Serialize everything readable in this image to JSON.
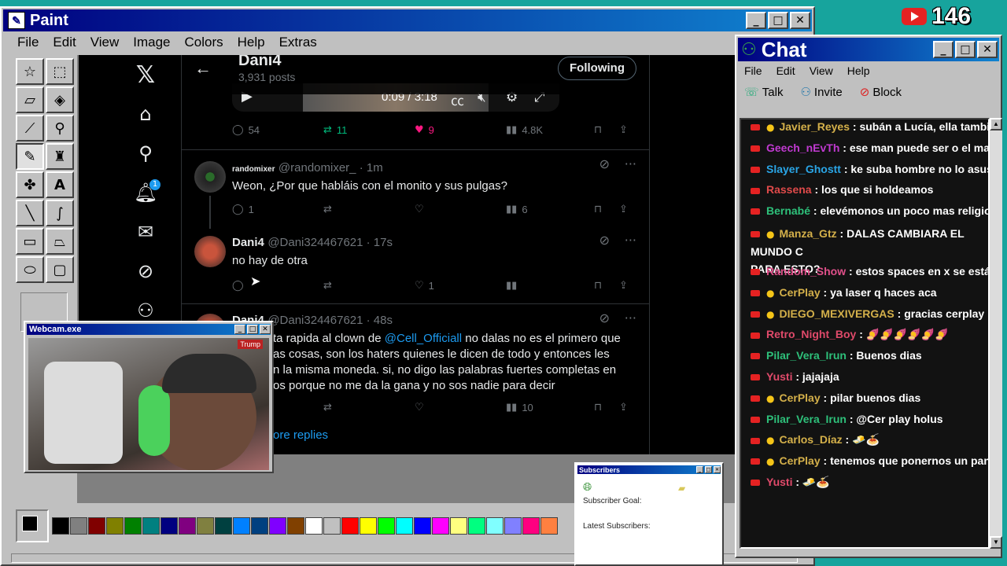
{
  "paint": {
    "title": "Paint",
    "menu": [
      "File",
      "Edit",
      "View",
      "Image",
      "Colors",
      "Help",
      "Extras"
    ],
    "tools": [
      "free-select",
      "rect-select",
      "eraser",
      "fill",
      "color-picker",
      "magnifier",
      "pencil",
      "brush",
      "airbrush",
      "text",
      "line",
      "curve",
      "rectangle",
      "polygon",
      "ellipse",
      "rounded-rectangle"
    ],
    "palette": [
      "#000000",
      "#808080",
      "#800000",
      "#808000",
      "#008000",
      "#008080",
      "#000080",
      "#800080",
      "#808040",
      "#004040",
      "#0080ff",
      "#004080",
      "#8000ff",
      "#804000",
      "#ffffff",
      "#c0c0c0",
      "#ff0000",
      "#ffff00",
      "#00ff00",
      "#00ffff",
      "#0000ff",
      "#ff00ff",
      "#ffff80",
      "#00ff80",
      "#80ffff",
      "#8080ff",
      "#ff0080",
      "#ff8040"
    ]
  },
  "x": {
    "header": {
      "name": "Dani4",
      "posts": "3,931 posts",
      "follow_label": "Following"
    },
    "video": {
      "time": "0:09 / 3:18"
    },
    "first_actions": {
      "replies": "54",
      "reposts": "11",
      "likes": "9",
      "views": "4.8K"
    },
    "posts": [
      {
        "name": "randomixer",
        "handle": "@randomixer_ · 1m",
        "text": "Weon, ¿Por que habláis con el monito y sus pulgas?",
        "replies": "1",
        "reposts": "",
        "likes": "",
        "views": "6"
      },
      {
        "name": "Dani4",
        "handle": "@Dani324467621 · 17s",
        "text": "no hay de otra",
        "replies": "",
        "reposts": "",
        "likes": "1",
        "views": ""
      },
      {
        "name": "Dani4",
        "handle": "@Dani324467621 · 48s",
        "text_pre": "ta rapida al clown de ",
        "mention": "@Cell_Officiall",
        "text_post": " no dalas no es el primero que",
        "lines": [
          "as cosas, son los haters quienes le dicen de todo y entonces les",
          "n la misma moneda. si, no digo las palabras fuertes completas en",
          "os porque no me da la gana y no sos nadie para decir"
        ],
        "replies": "",
        "reposts": "",
        "likes": "",
        "views": "10"
      }
    ],
    "more_replies": "ore replies"
  },
  "webcam": {
    "title": "Webcam.exe",
    "badge": "Trump"
  },
  "chat": {
    "title": "Chat",
    "menu": [
      "File",
      "Edit",
      "View",
      "Help"
    ],
    "toolbar": [
      "Talk",
      "Invite",
      "Block"
    ],
    "messages": [
      {
        "user": "Javier_Reyes",
        "color": "#d4b04a",
        "text": "subán a Lucía, ella también atra"
      },
      {
        "user": "Geech_nEvTh",
        "color": "#c03ad0",
        "text": "ese man puede ser o el mayor p"
      },
      {
        "user": "Slayer_Ghostt",
        "color": "#2aa5e6",
        "text": "ke suba hombre no lo asusten"
      },
      {
        "user": "Rassena",
        "color": "#e04a4a",
        "text": "los que si holdeamos"
      },
      {
        "user": "Bernabé",
        "color": "#2ec07a",
        "text": "elevémonos un poco mas religioso"
      },
      {
        "user": "Manza_Gtz",
        "color": "#d4b04a",
        "text": "DALAS CAMBIARA EL MUNDO C",
        "cont": "PARA ESTO?"
      },
      {
        "user": "Random_Show",
        "color": "#e0508a",
        "text": "estos spaces en x se están vol"
      },
      {
        "user": "CerPlay",
        "color": "#d4b04a",
        "text": "ya laser q haces aca"
      },
      {
        "user": "DIEGO_MEXIVERGAS",
        "color": "#d4b04a",
        "text": "gracias cerplay"
      },
      {
        "user": "Retro_Night_Boy",
        "color": "#e04a6a",
        "text": "🍠🍠🍠🍠🍠🍠"
      },
      {
        "user": "Pilar_Vera_Irun",
        "color": "#2ec07a",
        "text": "Buenos dias"
      },
      {
        "user": "Yusti",
        "color": "#e04a6a",
        "text": "jajajaja"
      },
      {
        "user": "CerPlay",
        "color": "#d4b04a",
        "text": "pilar buenos dias"
      },
      {
        "user": "Pilar_Vera_Irun",
        "color": "#2ec07a",
        "text": "@Cer play holus"
      },
      {
        "user": "Carlos_Díaz",
        "color": "#d4b04a",
        "text": "🧈🍝"
      },
      {
        "user": "CerPlay",
        "color": "#d4b04a",
        "text": "tenemos que ponernos un pan y un"
      },
      {
        "user": "Yusti",
        "color": "#e04a6a",
        "text": "🧈🍝"
      }
    ]
  },
  "subscribers": {
    "title": "Subscribers",
    "goal_label": "Subscriber Goal:",
    "latest_label": "Latest Subscribers:"
  },
  "youtube": {
    "count": "146"
  }
}
